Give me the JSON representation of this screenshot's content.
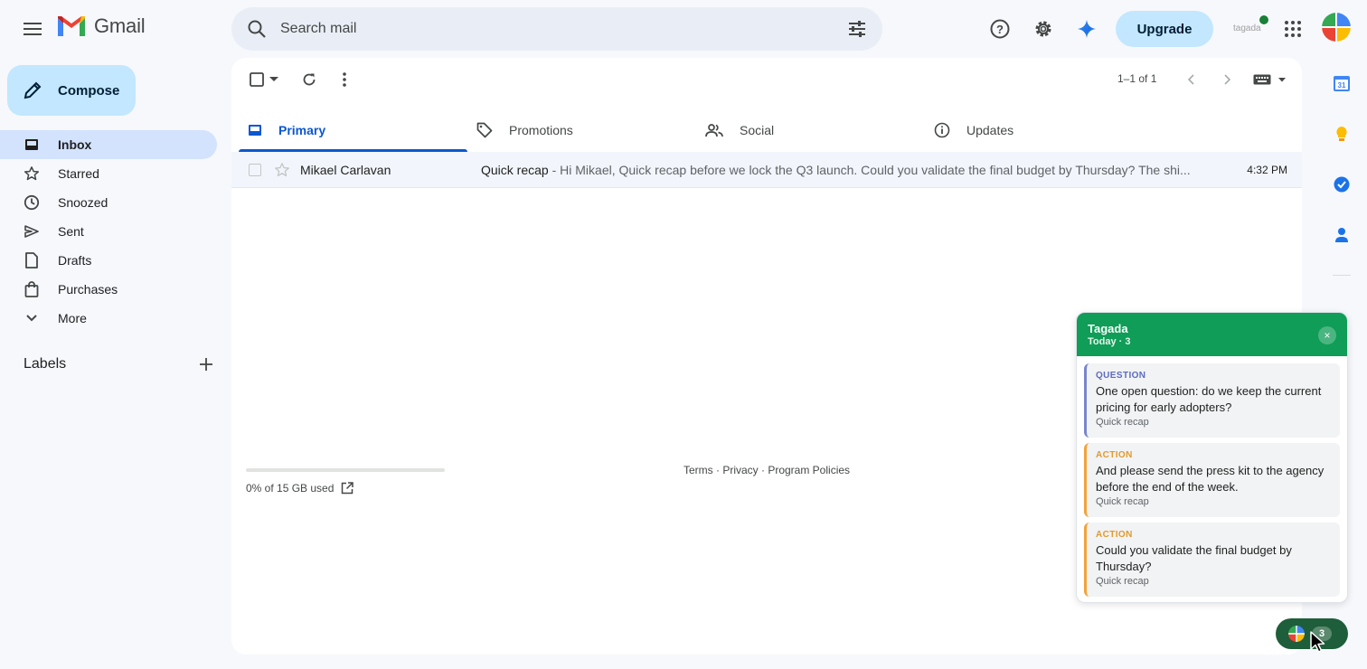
{
  "app": {
    "name": "Gmail"
  },
  "search": {
    "placeholder": "Search mail"
  },
  "header": {
    "upgrade_label": "Upgrade",
    "account_label": "tagada"
  },
  "compose": {
    "label": "Compose"
  },
  "sidebar": {
    "items": [
      {
        "label": "Inbox",
        "icon": "inbox-icon",
        "active": true
      },
      {
        "label": "Starred",
        "icon": "star-icon"
      },
      {
        "label": "Snoozed",
        "icon": "clock-icon"
      },
      {
        "label": "Sent",
        "icon": "send-icon"
      },
      {
        "label": "Drafts",
        "icon": "draft-icon"
      },
      {
        "label": "Purchases",
        "icon": "bag-icon"
      },
      {
        "label": "More",
        "icon": "chevron-down-icon"
      }
    ],
    "labels_title": "Labels"
  },
  "toolbar": {
    "pager": "1–1 of 1"
  },
  "tabs": [
    {
      "label": "Primary",
      "icon": "inbox-icon",
      "active": true
    },
    {
      "label": "Promotions",
      "icon": "tag-icon"
    },
    {
      "label": "Social",
      "icon": "people-icon"
    },
    {
      "label": "Updates",
      "icon": "info-icon"
    }
  ],
  "emails": [
    {
      "sender": "Mikael Carlavan",
      "subject": "Quick recap",
      "snippet": " - Hi Mikael, Quick recap before we lock the Q3 launch. Could you validate the final budget by Thursday? The shi...",
      "time": "4:32 PM"
    }
  ],
  "footer": {
    "storage": "0% of 15 GB used",
    "storage_percent": 0,
    "links": "Terms · Privacy · Program Policies"
  },
  "tagada_panel": {
    "title": "Tagada",
    "subtitle": "Today · 3",
    "close": "×",
    "cards": [
      {
        "kind": "QUESTION",
        "text": "One open question: do we keep the current pricing for early adopters?",
        "source": "Quick recap"
      },
      {
        "kind": "ACTION",
        "text": "And please send the press kit to the agency before the end of the week.",
        "source": "Quick recap"
      },
      {
        "kind": "ACTION",
        "text": "Could you validate the final budget by Thursday?",
        "source": "Quick recap"
      }
    ]
  },
  "fab": {
    "count": "3"
  },
  "colors": {
    "accent": "#0b57d0",
    "tagada_green": "#0f9d58",
    "compose_bg": "#c2e7ff"
  }
}
